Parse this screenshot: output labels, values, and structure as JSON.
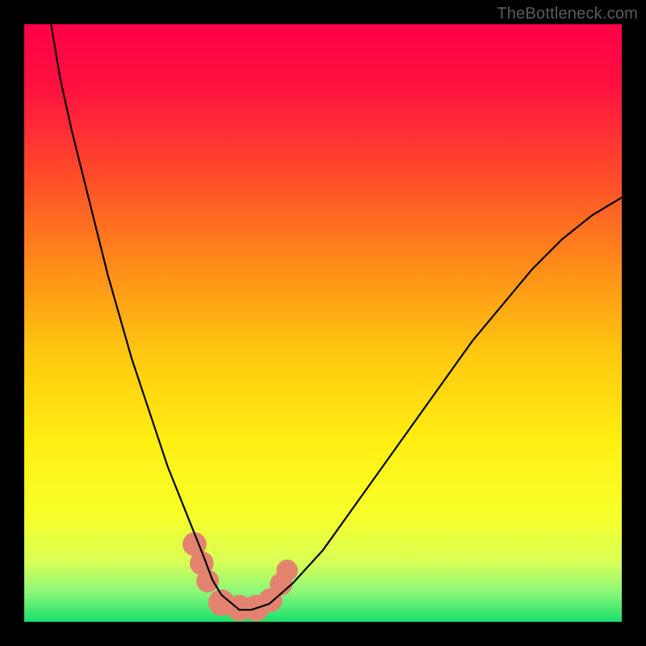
{
  "watermark": "TheBottleneck.com",
  "colors": {
    "page_bg": "#000000",
    "watermark_text": "#5c5c5c",
    "gradient_stops": [
      {
        "offset": 0.0,
        "color": "#ff0048"
      },
      {
        "offset": 0.1,
        "color": "#ff1040"
      },
      {
        "offset": 0.25,
        "color": "#ff4a2a"
      },
      {
        "offset": 0.4,
        "color": "#ff8a1a"
      },
      {
        "offset": 0.55,
        "color": "#ffc810"
      },
      {
        "offset": 0.7,
        "color": "#ffef12"
      },
      {
        "offset": 0.82,
        "color": "#f7ff2a"
      },
      {
        "offset": 0.9,
        "color": "#d8ff55"
      },
      {
        "offset": 0.95,
        "color": "#8cf77a"
      },
      {
        "offset": 1.0,
        "color": "#19e06a"
      }
    ],
    "curve_stroke": "#000000",
    "marker_fill": "#e3836f",
    "marker_stroke": "#c9624e"
  },
  "chart_data": {
    "type": "line",
    "title": "",
    "xlabel": "",
    "ylabel": "",
    "xlim": [
      0,
      100
    ],
    "ylim": [
      0,
      100
    ],
    "grid": false,
    "legend": false,
    "annotations": [],
    "note": "Axes are unlabeled in the source image; values are estimated on a 0–100 normalized scale from pixel geometry. y represents vertical distance from the bottom edge of the gradient panel (higher value = higher up / red region).",
    "series": [
      {
        "name": "curve",
        "x": [
          4.5,
          6,
          8,
          10,
          12,
          14,
          16,
          18,
          20,
          22,
          24,
          26,
          28,
          30,
          31.5,
          33,
          36,
          38,
          41,
          45,
          50,
          55,
          60,
          65,
          70,
          75,
          80,
          85,
          90,
          95,
          100
        ],
        "y": [
          100,
          91,
          82,
          74,
          66,
          58,
          51,
          44,
          38,
          32,
          26,
          21,
          16,
          11,
          7,
          4.5,
          2.0,
          2.0,
          3.0,
          6.5,
          12,
          19,
          26,
          33,
          40,
          47,
          53,
          59,
          64,
          68,
          71
        ]
      }
    ],
    "markers": {
      "note": "Approximate centers/sizes of the salmon-colored blobs near the curve minimum, in the same 0–100 chart space.",
      "items": [
        {
          "x": 28.5,
          "y": 13.0,
          "r": 2.0
        },
        {
          "x": 29.7,
          "y": 9.8,
          "r": 2.0
        },
        {
          "x": 30.7,
          "y": 6.8,
          "r": 1.9
        },
        {
          "x": 33.0,
          "y": 3.2,
          "r": 2.2
        },
        {
          "x": 36.0,
          "y": 2.3,
          "r": 2.2
        },
        {
          "x": 38.8,
          "y": 2.3,
          "r": 2.2
        },
        {
          "x": 41.2,
          "y": 3.6,
          "r": 2.0
        },
        {
          "x": 43.0,
          "y": 6.3,
          "r": 1.9
        },
        {
          "x": 44.0,
          "y": 8.6,
          "r": 1.8
        }
      ]
    }
  }
}
